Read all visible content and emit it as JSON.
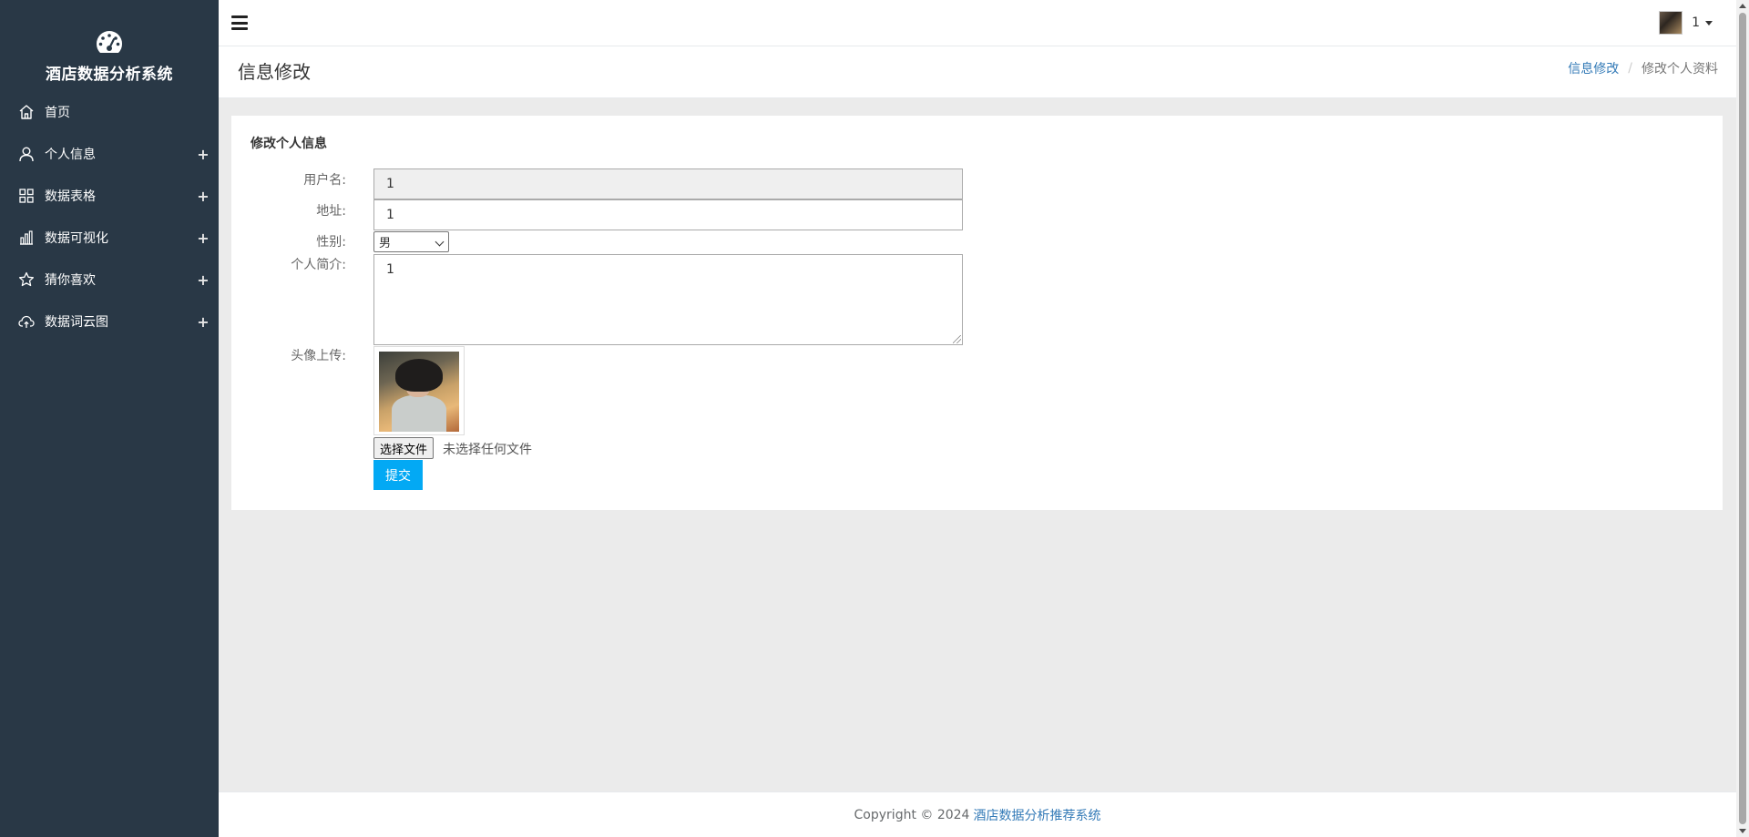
{
  "brand": {
    "title": "酒店数据分析系统",
    "icon": "dashboard-gauge-icon"
  },
  "sidebar": {
    "items": [
      {
        "label": "首页",
        "icon": "home-icon",
        "expandable": false
      },
      {
        "label": "个人信息",
        "icon": "user-icon",
        "expandable": true,
        "expand_symbol": "+"
      },
      {
        "label": "数据表格",
        "icon": "grid-icon",
        "expandable": true,
        "expand_symbol": "+"
      },
      {
        "label": "数据可视化",
        "icon": "bar-chart-icon",
        "expandable": true,
        "expand_symbol": "+"
      },
      {
        "label": "猜你喜欢",
        "icon": "star-icon",
        "expandable": true,
        "expand_symbol": "+"
      },
      {
        "label": "数据词云图",
        "icon": "cloud-upload-icon",
        "expandable": true,
        "expand_symbol": "+"
      }
    ]
  },
  "topbar": {
    "user_name": "1"
  },
  "page_heading": {
    "title": "信息修改",
    "breadcrumb": {
      "parent": "信息修改",
      "separator": "/",
      "current": "修改个人资料"
    }
  },
  "form": {
    "title": "修改个人信息",
    "username": {
      "label": "用户名:",
      "value": "1"
    },
    "address": {
      "label": "地址:",
      "value": "1"
    },
    "gender": {
      "label": "性别:",
      "selected": "男"
    },
    "bio": {
      "label": "个人简介:",
      "value": "1"
    },
    "avatar": {
      "label": "头像上传:",
      "choose_button": "选择文件",
      "file_status": "未选择任何文件"
    },
    "submit_label": "提交"
  },
  "footer": {
    "copyright": "Copyright © 2024",
    "link_text": "酒店数据分析推荐系统"
  },
  "colors": {
    "sidebar_bg": "#293846",
    "accent_button": "#03a9f4",
    "link": "#337ab7",
    "page_bg": "#ebebeb"
  }
}
